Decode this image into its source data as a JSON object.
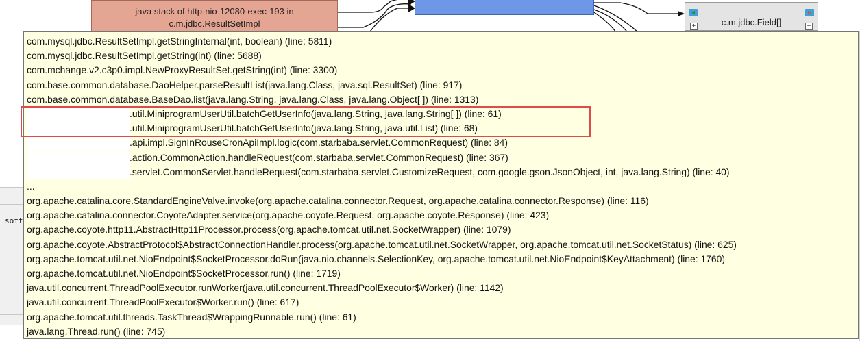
{
  "graph": {
    "java_node_lines": [
      "java stack of http-nio-12080-exec-193 in",
      "c.m.jdbc.ResultSetImpl"
    ],
    "field_node_label": "c.m.jdbc.Field[]",
    "expand_glyph": "+",
    "node_colors": {
      "java": "#e5a593",
      "blue": "#6f97e8",
      "field": "#e4e4e4"
    }
  },
  "left_panel": {
    "text": "soft"
  },
  "tooltip": {
    "background": "#ffffe1",
    "highlight_color": "#e04a4a",
    "frames": [
      {
        "text": "com.mysql.jdbc.ResultSetImpl.getStringInternal(int, boolean) (line: 5811)"
      },
      {
        "text": "com.mysql.jdbc.ResultSetImpl.getString(int) (line: 5688)"
      },
      {
        "text": "com.mchange.v2.c3p0.impl.NewProxyResultSet.getString(int) (line: 3300)"
      },
      {
        "text": "com.base.common.database.DaoHelper.parseResultList(java.lang.Class, java.sql.ResultSet) (line: 917)"
      },
      {
        "text": "com.base.common.database.BaseDao.list(java.lang.String, java.lang.Class, java.lang.Object[ ]) (line: 1313)"
      },
      {
        "text": ".util.MiniprogramUserUtil.batchGetUserInfo(java.lang.String, java.lang.String[ ]) (line: 61)",
        "redacted": true
      },
      {
        "text": ".util.MiniprogramUserUtil.batchGetUserInfo(java.lang.String, java.util.List) (line: 68)",
        "redacted": true
      },
      {
        "text": ".api.impl.SignInRouseCronApiImpl.logic(com.starbaba.servlet.CommonRequest) (line: 84)",
        "redacted": true
      },
      {
        "text": ".action.CommonAction.handleRequest(com.starbaba.servlet.CommonRequest) (line: 367)",
        "redacted": true
      },
      {
        "text": ".servlet.CommonServlet.handleRequest(com.starbaba.servlet.CustomizeRequest, com.google.gson.JsonObject, int, java.lang.String) (line: 40)",
        "redacted": true
      },
      {
        "text": "..."
      },
      {
        "text": "org.apache.catalina.core.StandardEngineValve.invoke(org.apache.catalina.connector.Request, org.apache.catalina.connector.Response) (line: 116)"
      },
      {
        "text": "org.apache.catalina.connector.CoyoteAdapter.service(org.apache.coyote.Request, org.apache.coyote.Response) (line: 423)"
      },
      {
        "text": "org.apache.coyote.http11.AbstractHttp11Processor.process(org.apache.tomcat.util.net.SocketWrapper) (line: 1079)"
      },
      {
        "text": "org.apache.coyote.AbstractProtocol$AbstractConnectionHandler.process(org.apache.tomcat.util.net.SocketWrapper, org.apache.tomcat.util.net.SocketStatus) (line: 625)"
      },
      {
        "text": "org.apache.tomcat.util.net.NioEndpoint$SocketProcessor.doRun(java.nio.channels.SelectionKey, org.apache.tomcat.util.net.NioEndpoint$KeyAttachment) (line: 1760)"
      },
      {
        "text": "org.apache.tomcat.util.net.NioEndpoint$SocketProcessor.run() (line: 1719)"
      },
      {
        "text": "java.util.concurrent.ThreadPoolExecutor.runWorker(java.util.concurrent.ThreadPoolExecutor$Worker) (line: 1142)"
      },
      {
        "text": "java.util.concurrent.ThreadPoolExecutor$Worker.run() (line: 617)"
      },
      {
        "text": "org.apache.tomcat.util.threads.TaskThread$WrappingRunnable.run() (line: 61)"
      },
      {
        "text": "java.lang.Thread.run() (line: 745)"
      }
    ]
  }
}
